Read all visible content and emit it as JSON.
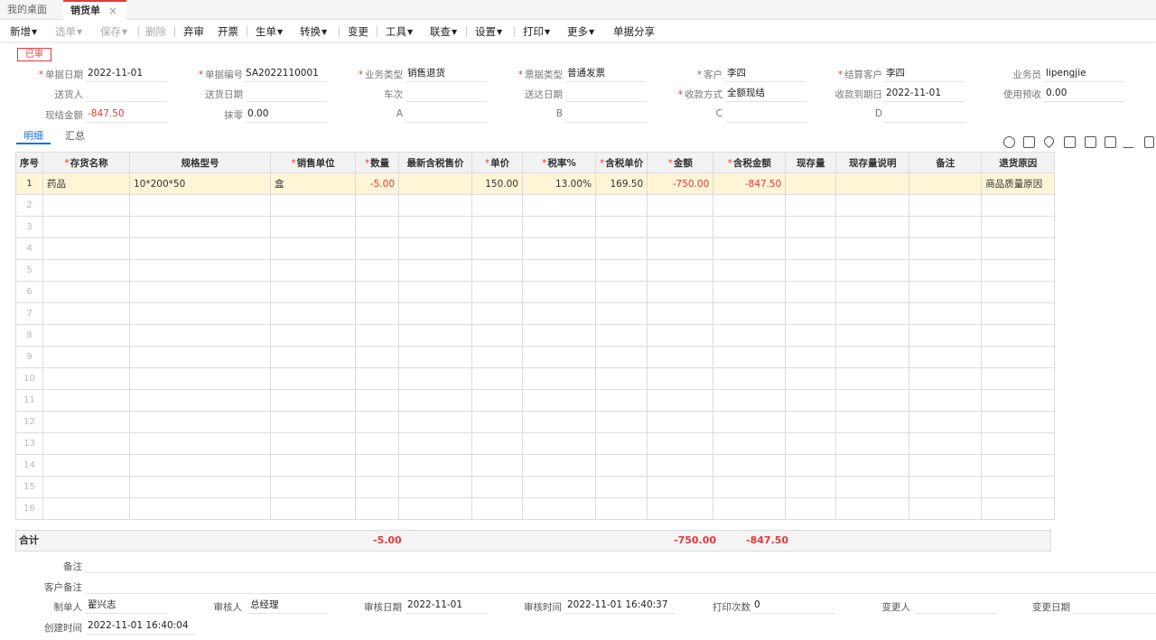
{
  "tabs": {
    "home": "我的桌面",
    "active": "销货单",
    "close": "×"
  },
  "toolbar": {
    "new": "新增",
    "select": "选单",
    "save": "保存",
    "delete": "删除",
    "abandon": "弃审",
    "invoice": "开票",
    "generate": "生单",
    "convert": "转换",
    "change": "变更",
    "tools": "工具",
    "linked": "联查",
    "settings": "设置",
    "print": "打印",
    "more": "更多",
    "share": "单据分享"
  },
  "status": "已审",
  "form": {
    "doc_date": {
      "label": "单据日期",
      "value": "2022-11-01"
    },
    "doc_no": {
      "label": "单据编号",
      "value": "SA2022110001"
    },
    "biz_type": {
      "label": "业务类型",
      "value": "销售退货"
    },
    "invoice_type": {
      "label": "票据类型",
      "value": "普通发票"
    },
    "customer": {
      "label": "客户",
      "value": "李四"
    },
    "settle_customer": {
      "label": "结算客户",
      "value": "李四"
    },
    "salesman": {
      "label": "业务员",
      "value": "lipengjie"
    },
    "delivery_person": {
      "label": "送货人",
      "value": ""
    },
    "delivery_date": {
      "label": "送货日期",
      "value": ""
    },
    "vehicle": {
      "label": "车次",
      "value": ""
    },
    "arrival_date": {
      "label": "送达日期",
      "value": ""
    },
    "payment_method": {
      "label": "收款方式",
      "value": "全额现结"
    },
    "due_date": {
      "label": "收款到期日",
      "value": "2022-11-01"
    },
    "use_prepay": {
      "label": "使用预收",
      "value": "0.00"
    },
    "cash_amount": {
      "label": "现结金额",
      "value": "-847.50"
    },
    "rounding": {
      "label": "抹零",
      "value": "0.00"
    },
    "a": {
      "label": "A",
      "value": ""
    },
    "b": {
      "label": "B",
      "value": ""
    },
    "c": {
      "label": "C",
      "value": ""
    },
    "d": {
      "label": "D",
      "value": ""
    }
  },
  "subtabs": {
    "detail": "明细",
    "summary": "汇总"
  },
  "grid": {
    "headers": [
      "序号",
      "存货名称",
      "规格型号",
      "销售单位",
      "数量",
      "最新含税售价",
      "单价",
      "税率%",
      "含税单价",
      "金额",
      "含税金额",
      "现存量",
      "现存量说明",
      "备注",
      "退货原因"
    ],
    "row1": {
      "seq": "1",
      "name": "药品",
      "spec": "10*200*50",
      "unit": "盒",
      "qty": "-5.00",
      "latest_price": "",
      "price": "150.00",
      "tax_rate": "13.00%",
      "tax_price": "169.50",
      "amount": "-750.00",
      "tax_amount": "-847.50",
      "stock": "",
      "stock_note": "",
      "remark": "",
      "reason": "商品质量原因"
    },
    "empty_rows": [
      "2",
      "3",
      "4",
      "5",
      "6",
      "7",
      "8",
      "9",
      "10",
      "11",
      "12",
      "13",
      "14",
      "15",
      "16"
    ]
  },
  "totals": {
    "label": "合计",
    "qty": "-5.00",
    "amount": "-750.00",
    "tax_amount": "-847.50"
  },
  "footer": {
    "remark_label": "备注",
    "customer_remark_label": "客户备注",
    "maker_label": "制单人",
    "maker": "翟兴志",
    "auditor_label": "审核人",
    "auditor": "总经理",
    "audit_date_label": "审核日期",
    "audit_date": "2022-11-01",
    "audit_time_label": "审核时间",
    "audit_time": "2022-11-01 16:40:37",
    "print_count_label": "打印次数",
    "print_count": "0",
    "changer_label": "变更人",
    "changer": "",
    "change_date_label": "变更日期",
    "change_date": "",
    "created_label": "创建时间",
    "created": "2022-11-01 16:40:04"
  },
  "colors": {
    "accent": "#e4393c",
    "link": "#1d6fd8",
    "selected_row": "#fdf5d6"
  }
}
